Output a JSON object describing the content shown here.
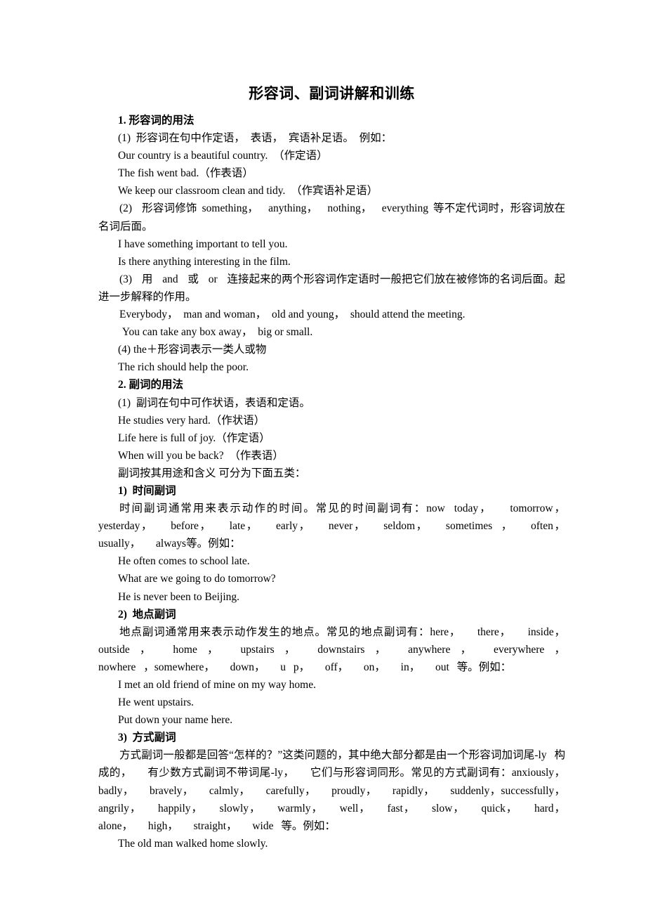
{
  "document": {
    "title": "形容词、副词讲解和训练",
    "blocks": [
      {
        "id": "h1",
        "text": "1. 形容词的用法"
      },
      {
        "id": "p1",
        "text": "(1)  形容词在句中作定语，  表语，  宾语补足语。  例如："
      },
      {
        "id": "p2",
        "text": "Our country is a beautiful country.  （作定语）"
      },
      {
        "id": "p3",
        "text": "The fish went bad.（作表语）"
      },
      {
        "id": "p4",
        "text": "We keep our classroom clean and tidy.  （作宾语补足语）"
      },
      {
        "id": "p5",
        "text": "(2)  形容词修饰 something，  anything，  nothing，  everything 等不定代词时，形容词放在名词后面。"
      },
      {
        "id": "p6",
        "text": "I have something important to tell you."
      },
      {
        "id": "p7",
        "text": "Is there anything interesting in the film."
      },
      {
        "id": "p8",
        "text": "(3)  用  and  或  or  连接起来的两个形容词作定语时一般把它们放在被修饰的名词后面。起进一步解释的作用。"
      },
      {
        "id": "p9",
        "text": "Everybody，  man and woman，  old and young，  should attend the meeting."
      },
      {
        "id": "p10",
        "text": " You can take any box away，  big or small."
      },
      {
        "id": "p11",
        "text": "(4) the＋形容词表示一类人或物"
      },
      {
        "id": "p12",
        "text": "The rich should help the poor."
      },
      {
        "id": "h2",
        "text": "2. 副词的用法"
      },
      {
        "id": "p13",
        "text": "(1)  副词在句中可作状语，表语和定语。"
      },
      {
        "id": "p14",
        "text": "He studies very hard.（作状语）"
      },
      {
        "id": "p15",
        "text": "Life here is full of joy.（作定语）"
      },
      {
        "id": "p16",
        "text": "When will you be back?  （作表语）"
      },
      {
        "id": "p17",
        "text": "副词按其用途和含义 可分为下面五类："
      },
      {
        "id": "h3",
        "text": "1)  时间副词"
      },
      {
        "id": "p18",
        "text": "时间副词通常用来表示动作的时间。常见的时间副词有：now today，  tomorrow，yesterday，  before，  late，  early，  never，  seldom，  sometimes ，  often，  usually，  always等。例如："
      },
      {
        "id": "p19",
        "text": "He often comes to school late."
      },
      {
        "id": "p20",
        "text": "What are we going to do tomorrow?"
      },
      {
        "id": "p21",
        "text": "He is never been to Beijing."
      },
      {
        "id": "h4",
        "text": "2)  地点副词"
      },
      {
        "id": "p22",
        "text": "地点副词通常用来表示动作发生的地点。常见的地点副词有：here，  there，  inside，outside ，  home ，  upstairs ，  downstairs ，  anywhere ，  everywhere ，  nowhere ，somewhere，  down，  u p，  off，  on，  in，  out 等。例如："
      },
      {
        "id": "p23",
        "text": "I met an old friend of mine on my way home."
      },
      {
        "id": "p24",
        "text": "He went upstairs."
      },
      {
        "id": "p25",
        "text": "Put down your name here."
      },
      {
        "id": "h5",
        "text": "3)  方式副词"
      },
      {
        "id": "p26",
        "text": "方式副词一般都是回答“怎样的？”这类问题的，其中绝大部分都是由一个形容词加词尾-ly 构成的，  有少数方式副词不带词尾-ly，  它们与形容词同形。常见的方式副词有：anxiously，  badly，  bravely，  calmly，  carefully，  proudly，  rapidly，  suddenly，successfully，  angrily，  happily，  slowly，  warmly，  well，  fast，  slow，  quick，  hard，alone，  high，  straight，  wide 等。例如："
      },
      {
        "id": "p27",
        "text": "The old man walked home slowly."
      }
    ]
  }
}
